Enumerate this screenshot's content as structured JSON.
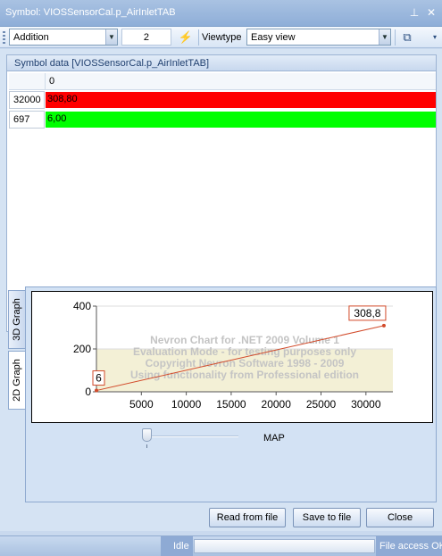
{
  "window": {
    "title": "Symbol: VIOSSensorCal.p_AirInletTAB"
  },
  "toolbar": {
    "operation": "Addition",
    "operand": "2",
    "viewtype_label": "Viewtype",
    "viewtype_value": "Easy view"
  },
  "grid": {
    "header": "Symbol data [VIOSSensorCal.p_AirInletTAB]",
    "column_headers": [
      "0"
    ],
    "rows": [
      {
        "label": "32000",
        "value": "308,80",
        "color": "#ff0000"
      },
      {
        "label": "697",
        "value": "6,00",
        "color": "#00ff00"
      }
    ]
  },
  "tabs": {
    "graph3d": "3D Graph",
    "graph2d": "2D Graph"
  },
  "chart_data": {
    "type": "line",
    "x": [
      0,
      32000
    ],
    "y": [
      6,
      308.8
    ],
    "point_labels": [
      "6",
      "308,8"
    ],
    "xlim": [
      0,
      33000
    ],
    "ylim": [
      0,
      400
    ],
    "xticks": [
      "5000",
      "10000",
      "15000",
      "20000",
      "25000",
      "30000"
    ],
    "yticks": [
      "0",
      "200",
      "400"
    ],
    "watermark": [
      "Nevron Chart for .NET 2009 Volume 1",
      "Evaluation Mode - for testing purposes only",
      "Copyright Nevron Software 1998 - 2009",
      "Using functionality from Professional edition"
    ],
    "series_color": "#d24a2a",
    "highlight_band": [
      0,
      200
    ],
    "highlight_color": "#f3f0d6"
  },
  "slider": {
    "label": "MAP",
    "level": 0
  },
  "buttons": {
    "read": "Read from file",
    "save": "Save to file",
    "close": "Close"
  },
  "status": {
    "idle": "Idle",
    "file": "File access OK"
  }
}
